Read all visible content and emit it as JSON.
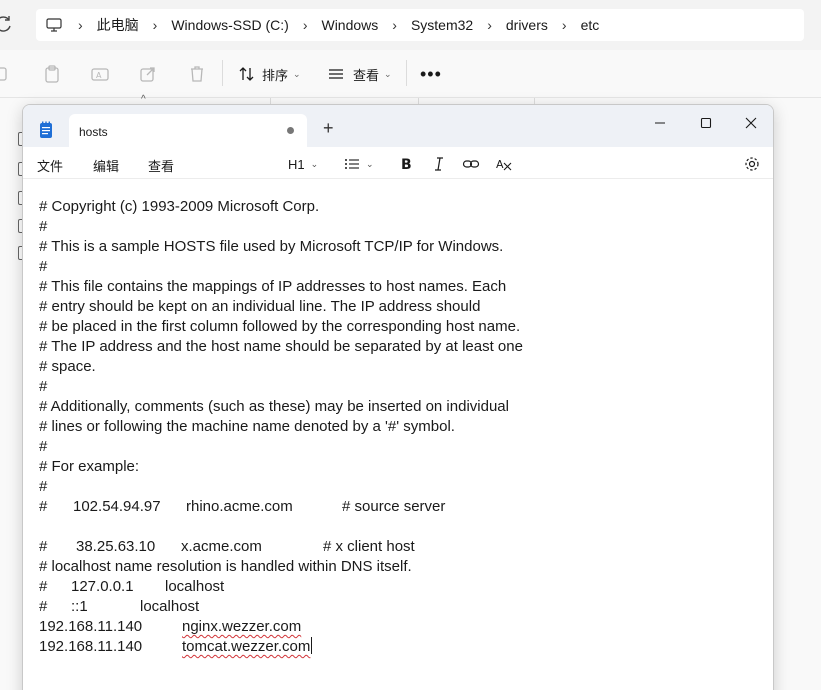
{
  "explorer": {
    "breadcrumb": [
      "此电脑",
      "Windows-SSD (C:)",
      "Windows",
      "System32",
      "drivers",
      "etc"
    ],
    "commands": {
      "sort_label": "排序",
      "view_label": "查看"
    }
  },
  "notepad": {
    "tab_title": "hosts",
    "menus": [
      "文件",
      "编辑",
      "查看"
    ],
    "heading_label": "H1",
    "lines": [
      "# Copyright (c) 1993-2009 Microsoft Corp.",
      "#",
      "# This is a sample HOSTS file used by Microsoft TCP/IP for Windows.",
      "#",
      "# This file contains the mappings of IP addresses to host names. Each",
      "# entry should be kept on an individual line. The IP address should",
      "# be placed in the first column followed by the corresponding host name.",
      "# The IP address and the host name should be separated by at least one",
      "# space.",
      "#",
      "# Additionally, comments (such as these) may be inserted on individual",
      "# lines or following the machine name denoted by a '#' symbol.",
      "#",
      "# For example:",
      "#"
    ],
    "examples": {
      "rhino": {
        "hash": "#",
        "ip": "102.54.94.97",
        "host": "rhino.acme.com",
        "comment": "# source server"
      },
      "xclient": {
        "hash": "#",
        "ip": "38.25.63.10",
        "host": "x.acme.com",
        "comment": "# x client host"
      },
      "localhost_note": "# localhost name resolution is handled within DNS itself.",
      "local4": {
        "hash": "#",
        "ip": "127.0.0.1",
        "host": "localhost"
      },
      "local6": {
        "hash": "#",
        "ip": "::1",
        "host": "localhost"
      }
    },
    "entries": [
      {
        "ip": "192.168.11.140",
        "host": "nginx.wezzer.com"
      },
      {
        "ip": "192.168.11.140",
        "host": "tomcat.wezzer.com"
      }
    ]
  }
}
